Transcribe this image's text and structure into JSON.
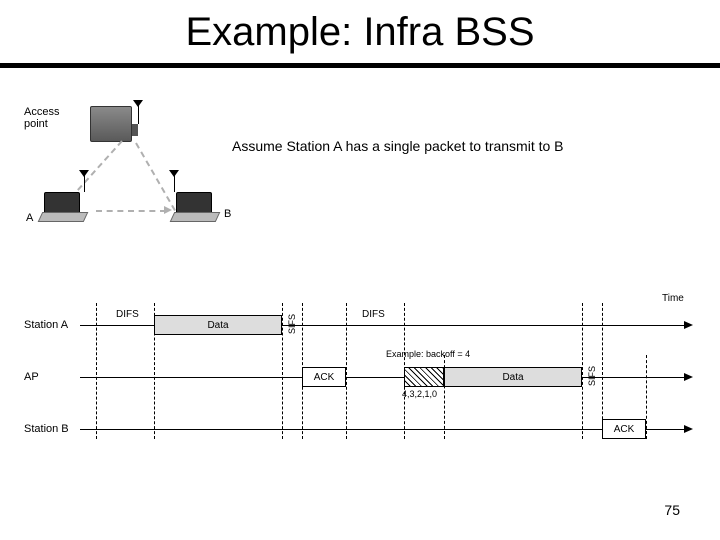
{
  "title": "Example: Infra BSS",
  "caption": "Assume Station A has a single packet to transmit to B",
  "page_number": "75",
  "topology": {
    "ap_label": "Access\npoint",
    "node_a_label": "A",
    "node_b_label": "B"
  },
  "timing": {
    "rows": {
      "station_a": "Station A",
      "ap": "AP",
      "station_b": "Station B"
    },
    "time_label": "Time",
    "labels": {
      "difs1": "DIFS",
      "data1": "Data",
      "sifs1": "SIFS",
      "ack1": "ACK",
      "difs2": "DIFS",
      "backoff_example": "Example: backoff = 4",
      "backoff_counts": "4,3,2,1,0",
      "data2": "Data",
      "sifs2": "SIFS",
      "ack2": "ACK"
    }
  }
}
